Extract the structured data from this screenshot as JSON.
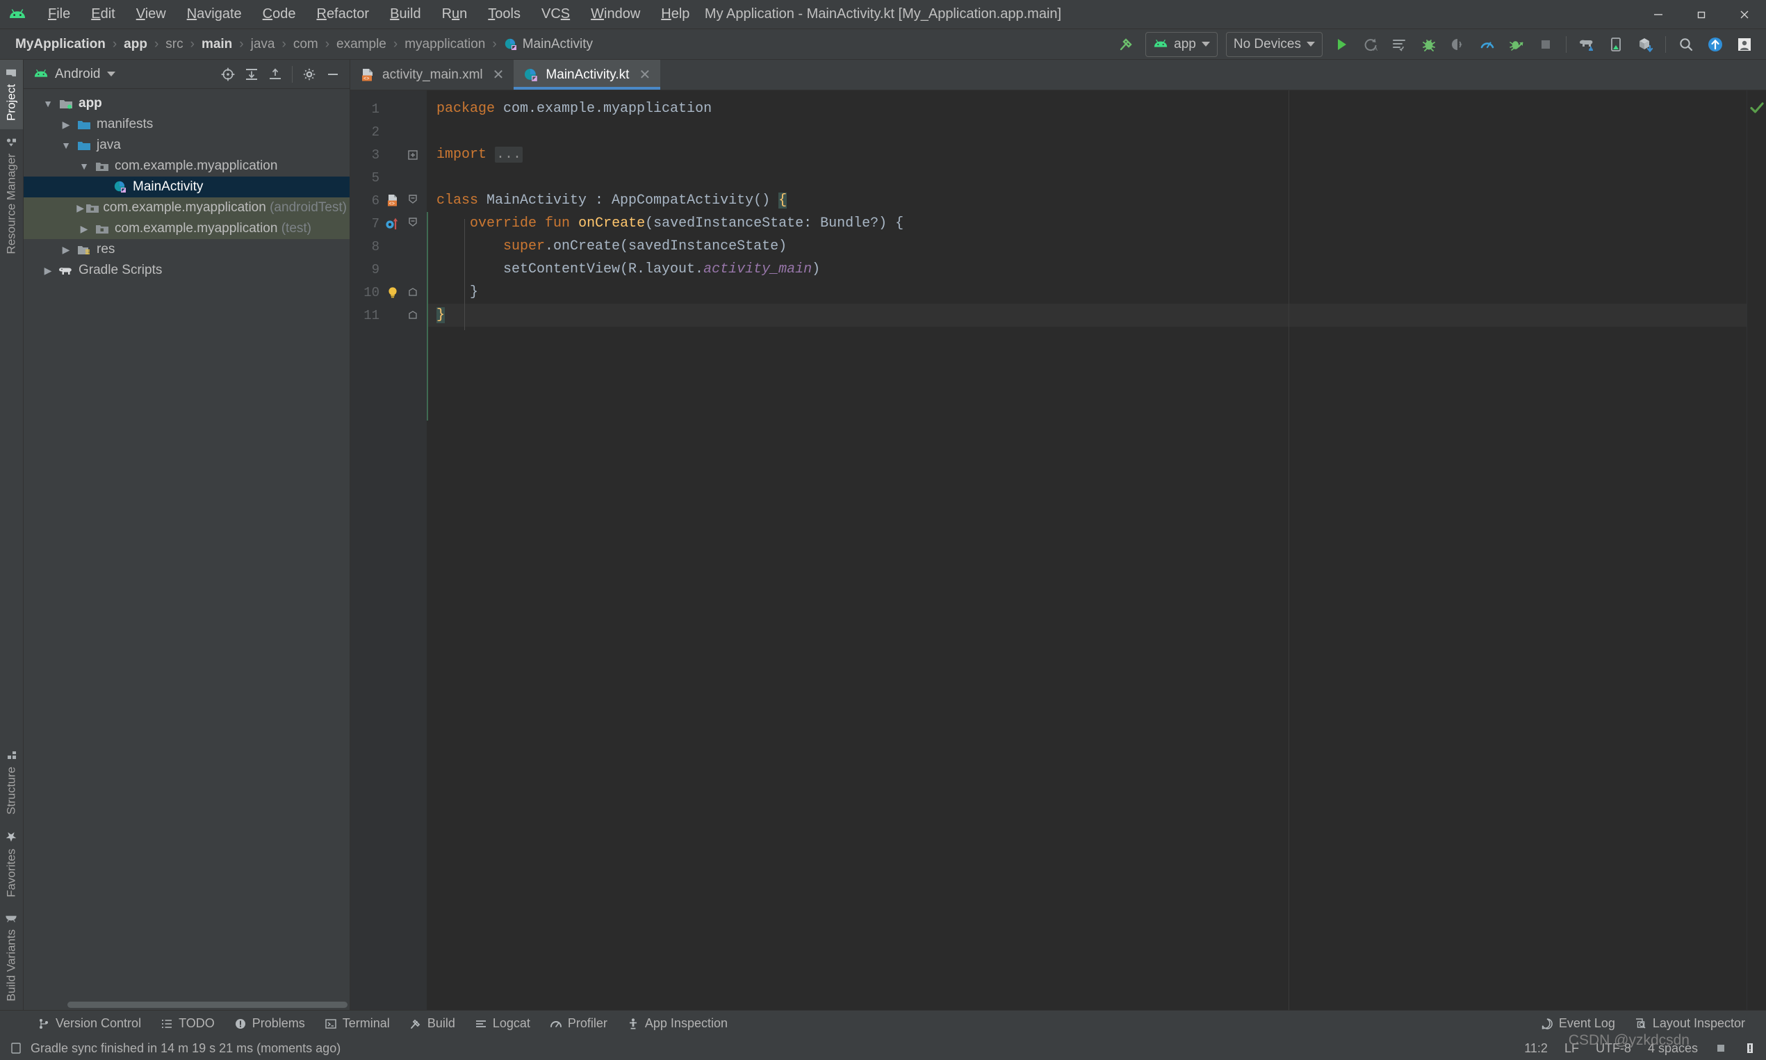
{
  "window": {
    "title": "My Application - MainActivity.kt [My_Application.app.main]",
    "app_icon": "android-logo-icon",
    "minimize_label": "–",
    "maximize_label": "❐",
    "close_label": "✕"
  },
  "menu": [
    {
      "label": "File",
      "mnemonic": "F"
    },
    {
      "label": "Edit",
      "mnemonic": "E"
    },
    {
      "label": "View",
      "mnemonic": "V"
    },
    {
      "label": "Navigate",
      "mnemonic": "N"
    },
    {
      "label": "Code",
      "mnemonic": "C"
    },
    {
      "label": "Refactor",
      "mnemonic": "R"
    },
    {
      "label": "Build",
      "mnemonic": "B"
    },
    {
      "label": "Run",
      "mnemonic": "u"
    },
    {
      "label": "Tools",
      "mnemonic": "T"
    },
    {
      "label": "VCS",
      "mnemonic": "S"
    },
    {
      "label": "Window",
      "mnemonic": "W"
    },
    {
      "label": "Help",
      "mnemonic": "H"
    }
  ],
  "breadcrumb": [
    {
      "label": "MyApplication",
      "bold": true
    },
    {
      "label": "app",
      "bold": true
    },
    {
      "label": "src",
      "bold": false
    },
    {
      "label": "main",
      "bold": true
    },
    {
      "label": "java",
      "bold": false
    },
    {
      "label": "com",
      "bold": false
    },
    {
      "label": "example",
      "bold": false
    },
    {
      "label": "myapplication",
      "bold": false
    },
    {
      "label": "MainActivity",
      "bold": false,
      "icon": "kotlin-class-icon"
    }
  ],
  "toolbar": {
    "build_hammer_icon": "build-hammer-icon",
    "run_config_label": "app",
    "run_config_icon": "android-logo-icon",
    "device_label": "No Devices",
    "run_icon": "run-triangle-icon",
    "apply_changes_icon": "apply-changes-icon",
    "apply_code_changes_icon": "apply-code-changes-icon",
    "debug_icon": "debug-bug-icon",
    "attach_debugger_icon": "attach-debugger-icon",
    "profiler_icon": "profiler-gauge-icon",
    "run_profile_icon": "run-with-profiler-icon",
    "stop_icon": "stop-square-icon",
    "sync_gradle_icon": "sync-gradle-elephant-icon",
    "avd_manager_icon": "avd-manager-icon",
    "sdk_manager_icon": "sdk-manager-icon",
    "search_icon": "search-icon",
    "update_icon": "update-arrow-icon",
    "account_icon": "account-icon"
  },
  "left_strip": {
    "top": [
      {
        "label": "Project",
        "icon": "project-folder-icon",
        "active": true
      },
      {
        "label": "Resource Manager",
        "icon": "resource-manager-icon",
        "active": false
      }
    ],
    "bottom": [
      {
        "label": "Structure",
        "icon": "structure-icon",
        "active": false
      },
      {
        "label": "Favorites",
        "icon": "favorites-star-icon",
        "active": false
      },
      {
        "label": "Build Variants",
        "icon": "build-variants-icon",
        "active": false
      }
    ]
  },
  "project_panel": {
    "title": "Android",
    "title_icon": "android-logo-icon",
    "tools": [
      {
        "name": "select-opened-file-icon",
        "glyph": "target"
      },
      {
        "name": "expand-all-icon",
        "glyph": "expand"
      },
      {
        "name": "collapse-all-icon",
        "glyph": "collapse"
      },
      {
        "name": "settings-gear-icon",
        "glyph": "gear"
      },
      {
        "name": "hide-panel-icon",
        "glyph": "minus"
      }
    ],
    "tree": [
      {
        "label": "app",
        "indent": 0,
        "arrow": "down",
        "icon": "module-folder-icon",
        "bold": true,
        "state": "normal"
      },
      {
        "label": "manifests",
        "indent": 1,
        "arrow": "right",
        "icon": "folder-blue-icon",
        "bold": false,
        "state": "normal"
      },
      {
        "label": "java",
        "indent": 1,
        "arrow": "down",
        "icon": "folder-blue-icon",
        "bold": false,
        "state": "normal"
      },
      {
        "label": "com.example.myapplication",
        "indent": 2,
        "arrow": "down",
        "icon": "package-folder-icon",
        "bold": false,
        "state": "normal"
      },
      {
        "label": "MainActivity",
        "indent": 3,
        "arrow": "none",
        "icon": "kotlin-class-icon",
        "bold": false,
        "state": "selected"
      },
      {
        "label": "com.example.myapplication",
        "suffix": " (androidTest)",
        "indent": 2,
        "arrow": "right",
        "icon": "package-folder-icon",
        "bold": false,
        "state": "testsrc"
      },
      {
        "label": "com.example.myapplication",
        "suffix": " (test)",
        "indent": 2,
        "arrow": "right",
        "icon": "package-folder-icon",
        "bold": false,
        "state": "testsrc"
      },
      {
        "label": "res",
        "indent": 1,
        "arrow": "right",
        "icon": "res-folder-icon",
        "bold": false,
        "state": "normal"
      },
      {
        "label": "Gradle Scripts",
        "indent": 0,
        "arrow": "right",
        "icon": "gradle-elephant-icon",
        "bold": false,
        "state": "normal"
      }
    ]
  },
  "editor": {
    "tabs": [
      {
        "label": "activity_main.xml",
        "icon": "xml-layout-icon",
        "active": false,
        "close": "✕"
      },
      {
        "label": "MainActivity.kt",
        "icon": "kotlin-class-icon",
        "active": true,
        "close": "✕"
      }
    ],
    "lines": [
      {
        "num": "1",
        "fold": "",
        "gutter": "",
        "cursor": false
      },
      {
        "num": "2",
        "fold": "",
        "gutter": "",
        "cursor": false
      },
      {
        "num": "3",
        "fold": "plus",
        "gutter": "",
        "cursor": false
      },
      {
        "num": "5",
        "fold": "",
        "gutter": "",
        "cursor": false
      },
      {
        "num": "6",
        "fold": "minus",
        "gutter": "xml-layout-icon",
        "cursor": false
      },
      {
        "num": "7",
        "fold": "minus",
        "gutter": "override-method-icon",
        "cursor": false
      },
      {
        "num": "8",
        "fold": "",
        "gutter": "",
        "cursor": false
      },
      {
        "num": "9",
        "fold": "",
        "gutter": "",
        "cursor": false
      },
      {
        "num": "10",
        "fold": "end",
        "gutter": "intention-bulb-icon",
        "cursor": false
      },
      {
        "num": "11",
        "fold": "end",
        "gutter": "",
        "cursor": true
      }
    ],
    "code": {
      "l1_kw": "package",
      "l1_rest": " com.example.myapplication",
      "l3_kw": "import",
      "l3_folded": "...",
      "l6_kw": "class",
      "l6_rest": " MainActivity : AppCompatActivity() ",
      "l6_brace": "{",
      "l7_kw1": "override",
      "l7_kw2": "fun",
      "l7_fn": "onCreate",
      "l7_rest": "(savedInstanceState: Bundle?) {",
      "l8_kw": "super",
      "l8_rest": ".onCreate(savedInstanceState)",
      "l9_a": "setContentView(R.layout.",
      "l9_res": "activity_main",
      "l9_b": ")",
      "l10": "}",
      "l11": "}"
    },
    "inspection_status_icon": "no-errors-check-icon"
  },
  "bottom_toolbar": {
    "items": [
      {
        "label": "Version Control",
        "icon": "version-control-icon"
      },
      {
        "label": "TODO",
        "icon": "todo-list-icon"
      },
      {
        "label": "Problems",
        "icon": "problems-icon"
      },
      {
        "label": "Terminal",
        "icon": "terminal-icon"
      },
      {
        "label": "Build",
        "icon": "build-hammer-icon"
      },
      {
        "label": "Logcat",
        "icon": "logcat-icon"
      },
      {
        "label": "Profiler",
        "icon": "profiler-gauge-icon"
      },
      {
        "label": "App Inspection",
        "icon": "app-inspection-icon"
      }
    ],
    "right": [
      {
        "label": "Event Log",
        "icon": "event-log-icon"
      },
      {
        "label": "Layout Inspector",
        "icon": "layout-inspector-icon"
      }
    ]
  },
  "statusbar": {
    "message_icon": "notification-icon",
    "message": "Gradle sync finished in 14 m 19 s 21 ms (moments ago)",
    "caret_position": "11:2",
    "line_separator": "LF",
    "encoding": "UTF-8",
    "indent": "4 spaces",
    "lock_icon": "read-only-toggle-icon",
    "inspector_icon": "inspection-level-icon",
    "watermark": "CSDN @yzkdcsdn"
  },
  "colors": {
    "chrome": "#3c3f41",
    "editor_bg": "#2b2b2b",
    "gutter_bg": "#313335",
    "accent_blue": "#4a88c7",
    "selection_blue": "#0d293e",
    "test_green": "#4a5145",
    "keyword_orange": "#cc7832",
    "method_yellow": "#ffc66d",
    "resource_purple": "#9876aa",
    "android_green": "#3ddc84",
    "ok_green": "#5a9e4b"
  }
}
